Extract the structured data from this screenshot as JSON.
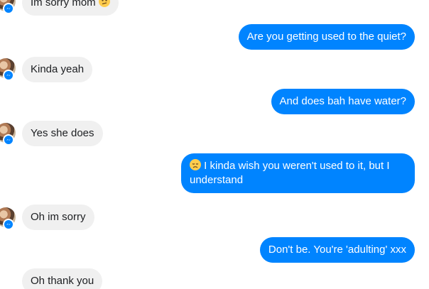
{
  "messages": [
    {
      "side": "in",
      "text": "Im sorry mom",
      "emoji": "confused-face-emoji"
    },
    {
      "side": "out",
      "text": "Are you getting used to the quiet?"
    },
    {
      "side": "in",
      "text": "Kinda yeah"
    },
    {
      "side": "out",
      "text": "And does bah have water?"
    },
    {
      "side": "in",
      "text": "Yes she does"
    },
    {
      "side": "out",
      "text": "I kinda wish you weren't used to it, but I understand",
      "emoji": "disappointed-face-emoji"
    },
    {
      "side": "in",
      "text": "Oh im sorry"
    },
    {
      "side": "out",
      "text": "Don't be. You're 'adulting' xxx"
    },
    {
      "side": "in",
      "text": "Oh thank you"
    }
  ],
  "colors": {
    "outgoing_bubble": "#0084ff",
    "incoming_bubble": "#f0f0f0",
    "messenger_badge": "#0084ff"
  }
}
